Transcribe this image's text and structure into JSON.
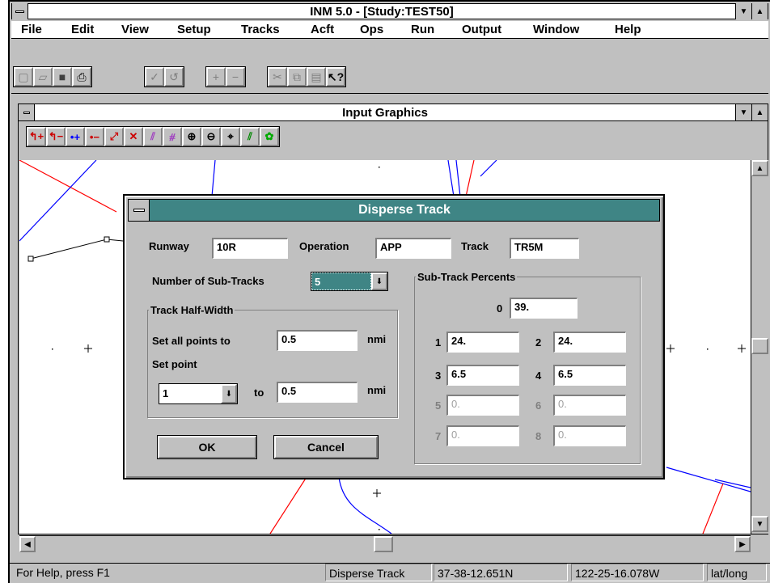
{
  "app": {
    "title": "INM 5.0 - [Study:TEST50]"
  },
  "menu": [
    "File",
    "Edit",
    "View",
    "Setup",
    "Tracks",
    "Acft",
    "Ops",
    "Run",
    "Output",
    "Window",
    "Help"
  ],
  "child": {
    "title": "Input Graphics"
  },
  "dialog": {
    "title": "Disperse Track",
    "runway_label": "Runway",
    "runway_value": "10R",
    "operation_label": "Operation",
    "operation_value": "APP",
    "track_label": "Track",
    "track_value": "TR5M",
    "subtracks_label": "Number of Sub-Tracks",
    "subtracks_value": "5",
    "halfwidth_group": "Track Half-Width",
    "setall_label": "Set all points to",
    "setall_value": "0.5",
    "nmi": "nmi",
    "setpoint_label": "Set point",
    "point_value": "1",
    "to_label": "to",
    "to_value": "0.5",
    "ok": "OK",
    "cancel": "Cancel",
    "percents_group": "Sub-Track Percents",
    "p0_label": "0",
    "p0": "39.",
    "p1_label": "1",
    "p1": "24.",
    "p2_label": "2",
    "p2": "24.",
    "p3_label": "3",
    "p3": "6.5",
    "p4_label": "4",
    "p4": "6.5",
    "p5_label": "5",
    "p5": "0.",
    "p6_label": "6",
    "p6": "0.",
    "p7_label": "7",
    "p7": "0.",
    "p8_label": "8",
    "p8": "0."
  },
  "status": {
    "help": "For Help, press F1",
    "mode": "Disperse Track",
    "lat": "37-38-12.651N",
    "lon": "122-25-16.078W",
    "units": "lat/long"
  },
  "colors": {
    "dialog_title": "#3f8585",
    "track_blue": "#0000ff",
    "track_red": "#ff0000"
  }
}
